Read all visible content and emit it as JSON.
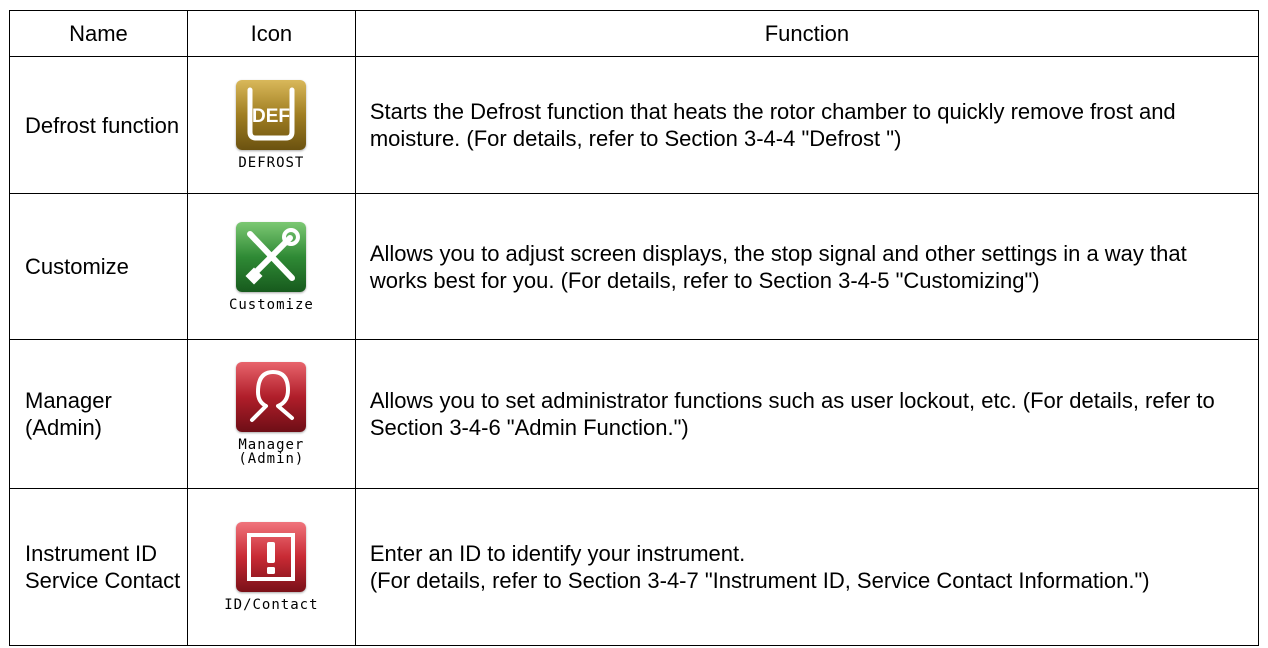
{
  "table": {
    "headers": {
      "name": "Name",
      "icon": "Icon",
      "function": "Function"
    },
    "rows": [
      {
        "name": "Defrost function",
        "icon_name": "defrost-icon",
        "icon_text": "DEF",
        "icon_label": "DEFROST",
        "function": "Starts the Defrost function that heats the rotor chamber to quickly remove frost and moisture. (For details, refer to Section 3-4-4 \"Defrost \")"
      },
      {
        "name": "Customize",
        "icon_name": "customize-icon",
        "icon_label": "Customize",
        "function": "Allows you to adjust screen displays, the stop signal and other settings in a way that works best for you. (For details, refer to Section 3-4-5 \"Customizing\")"
      },
      {
        "name": "Manager (Admin)",
        "icon_name": "manager-icon",
        "icon_label": "Manager\n(Admin)",
        "function": "Allows you to set administrator functions such as user lockout, etc. (For details, refer to Section 3-4-6 \"Admin Function.\")"
      },
      {
        "name": "Instrument ID Service Contact",
        "icon_name": "id-contact-icon",
        "icon_label": "ID/Contact",
        "function_lines": [
          "Enter an ID to identify your instrument.",
          "(For details, refer to Section 3-4-7 \"Instrument ID, Service Contact Information.\")"
        ]
      }
    ]
  },
  "colors": {
    "defrost": "#9c7a1e",
    "customize": "#2f8a35",
    "manager": "#b01e2a",
    "id_contact": "#c82a34"
  }
}
